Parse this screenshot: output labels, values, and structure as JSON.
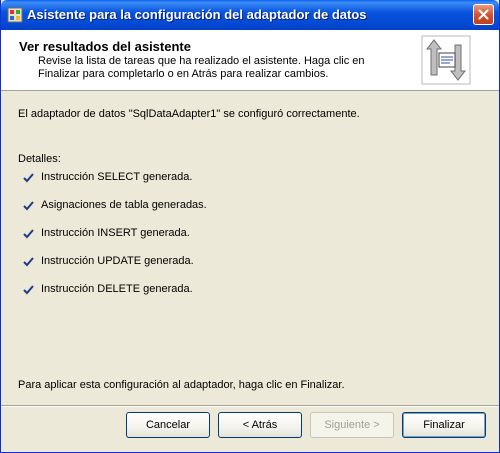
{
  "window": {
    "title": "Asistente para la configuración del adaptador de datos"
  },
  "header": {
    "title": "Ver resultados del asistente",
    "description": "Revise la lista de tareas que ha realizado el asistente. Haga clic en Finalizar para completarlo o en Atrás para realizar cambios."
  },
  "content": {
    "message": "El adaptador de datos \"SqlDataAdapter1\" se configuró correctamente.",
    "details_label": "Detalles:",
    "details": [
      "Instrucción SELECT generada.",
      "Asignaciones de tabla generadas.",
      "Instrucción INSERT generada.",
      "Instrucción UPDATE generada.",
      "Instrucción DELETE generada."
    ],
    "footer_message": "Para aplicar esta configuración al adaptador, haga clic en Finalizar."
  },
  "buttons": {
    "cancel": "Cancelar",
    "back": "< Atrás",
    "next": "Siguiente >",
    "finish": "Finalizar"
  },
  "colors": {
    "titlebar": "#0855DD",
    "dialog_bg": "#ECE9D8",
    "check": "#1F3C88"
  }
}
